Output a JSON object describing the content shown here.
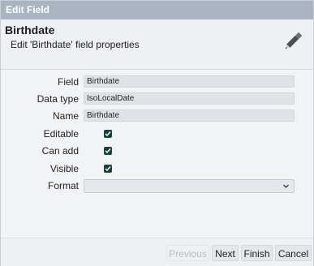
{
  "dialog": {
    "title": "Edit Field",
    "heading": "Birthdate",
    "subtitle": "Edit 'Birthdate' field properties",
    "icon": "edit-icon"
  },
  "form": {
    "field_label": "Field",
    "field_value": "Birthdate",
    "datatype_label": "Data type",
    "datatype_value": "IsoLocalDate",
    "name_label": "Name",
    "name_value": "Birthdate",
    "editable_label": "Editable",
    "editable_checked": true,
    "canadd_label": "Can add",
    "canadd_checked": true,
    "visible_label": "Visible",
    "visible_checked": true,
    "format_label": "Format",
    "format_value": ""
  },
  "footer": {
    "previous_label": "Previous",
    "next_label": "Next",
    "finish_label": "Finish",
    "cancel_label": "Cancel"
  },
  "colors": {
    "titlebar": "#a9b4c2",
    "checkbox": "#17413c",
    "background": "#eef0f3"
  }
}
